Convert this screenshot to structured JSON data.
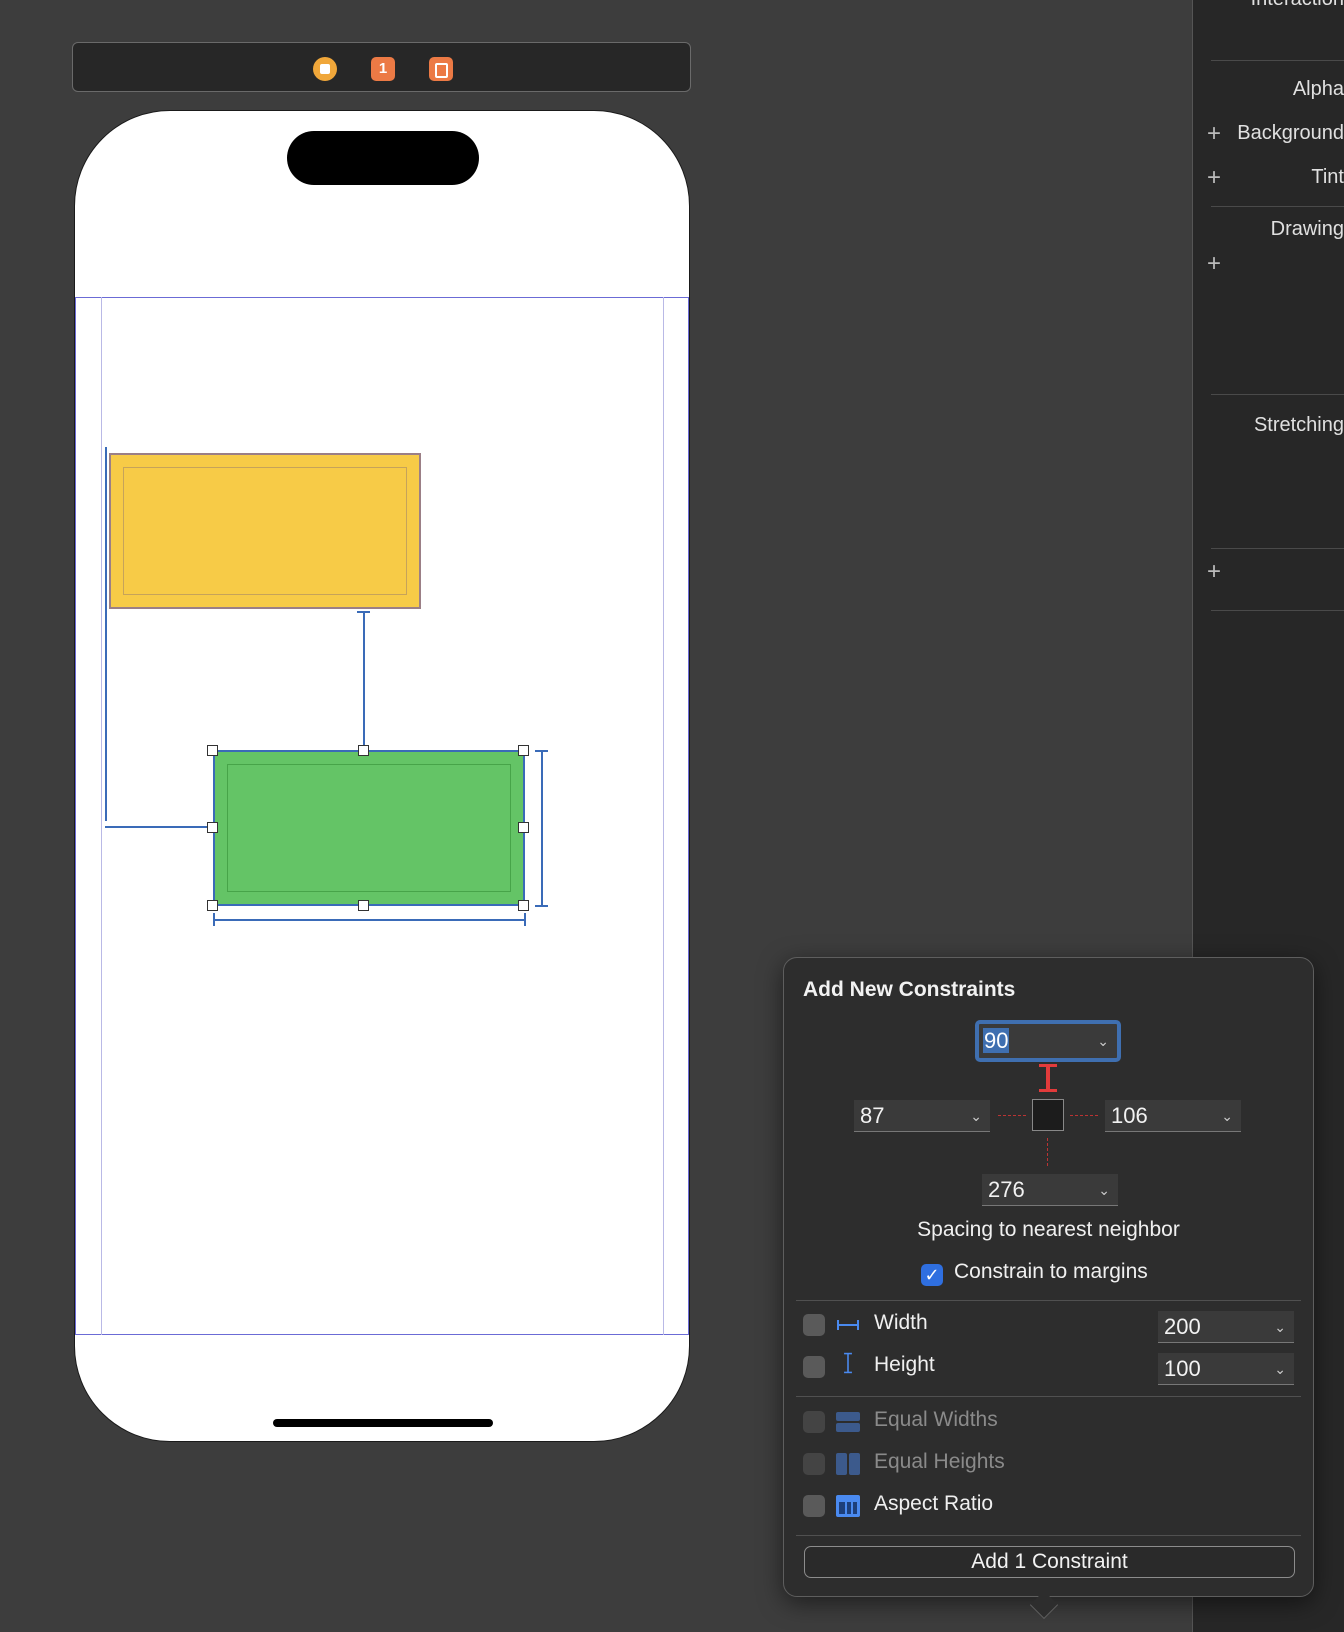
{
  "scene_dock": {
    "icons": [
      "view-controller-icon",
      "first-responder-icon",
      "exit-icon"
    ],
    "first_responder_label": "1"
  },
  "inspector": {
    "items": [
      {
        "label": "Interaction"
      },
      {
        "label": "Alpha"
      },
      {
        "label": "Background"
      },
      {
        "label": "Tint"
      },
      {
        "label": "Drawing"
      },
      {
        "label": "Stretching"
      }
    ]
  },
  "canvas": {
    "views": [
      {
        "name": "yellow-view",
        "color": "#f7cb47"
      },
      {
        "name": "green-view",
        "color": "#64c466"
      }
    ]
  },
  "constraints_popover": {
    "title": "Add New Constraints",
    "top_value": "90",
    "leading_value": "87",
    "trailing_value": "106",
    "bottom_value": "276",
    "spacing_caption": "Spacing to nearest neighbor",
    "constrain_to_margins": {
      "label": "Constrain to margins",
      "checked": true
    },
    "width": {
      "label": "Width",
      "value": "200",
      "checked": false
    },
    "height": {
      "label": "Height",
      "value": "100",
      "checked": false
    },
    "equal_widths": {
      "label": "Equal Widths",
      "enabled": false
    },
    "equal_heights": {
      "label": "Equal Heights",
      "enabled": false
    },
    "aspect_ratio": {
      "label": "Aspect Ratio",
      "enabled": true
    },
    "add_button": "Add 1 Constraint"
  },
  "colors": {
    "accent": "#2f6fe0",
    "constraint_line": "#3a6bb8",
    "strut_active": "#e23b3b"
  }
}
